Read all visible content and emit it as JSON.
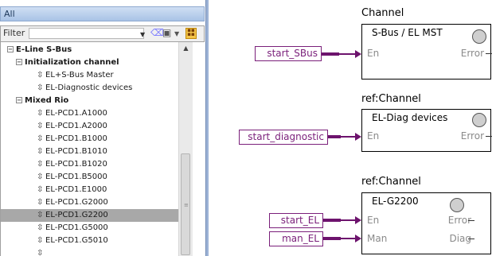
{
  "library": {
    "tab_label": "All",
    "filter_label": "Filter",
    "filter_value": "",
    "tree": [
      {
        "label": "E-Line S-Bus",
        "type": "group",
        "level": 0
      },
      {
        "label": "Initialization channel",
        "type": "group",
        "level": 1
      },
      {
        "label": "EL+S-Bus Master",
        "type": "leaf",
        "level": 2
      },
      {
        "label": "EL-Diagnostic devices",
        "type": "leaf",
        "level": 2
      },
      {
        "label": "Mixed Rio",
        "type": "group",
        "level": 1
      },
      {
        "label": "EL-PCD1.A1000",
        "type": "leaf",
        "level": 2
      },
      {
        "label": "EL-PCD1.A2000",
        "type": "leaf",
        "level": 2
      },
      {
        "label": "EL-PCD1.B1000",
        "type": "leaf",
        "level": 2
      },
      {
        "label": "EL-PCD1.B1010",
        "type": "leaf",
        "level": 2
      },
      {
        "label": "EL-PCD1.B1020",
        "type": "leaf",
        "level": 2
      },
      {
        "label": "EL-PCD1.B5000",
        "type": "leaf",
        "level": 2
      },
      {
        "label": "EL-PCD1.E1000",
        "type": "leaf",
        "level": 2
      },
      {
        "label": "EL-PCD1.G2000",
        "type": "leaf",
        "level": 2
      },
      {
        "label": "EL-PCD1.G2200",
        "type": "leaf",
        "level": 2,
        "selected": true
      },
      {
        "label": "EL-PCD1.G5000",
        "type": "leaf",
        "level": 2
      },
      {
        "label": "EL-PCD1.G5010",
        "type": "leaf",
        "level": 2
      }
    ]
  },
  "diagram": {
    "blocks": [
      {
        "title": "Channel",
        "name": "S-Bus / EL MST",
        "in_ports": [
          "En"
        ],
        "out_ports": [
          "Error"
        ]
      },
      {
        "title": "ref:Channel",
        "name": "EL-Diag devices",
        "in_ports": [
          "En"
        ],
        "out_ports": [
          "Error"
        ]
      },
      {
        "title": "ref:Channel",
        "name": "EL-G2200",
        "in_ports": [
          "En",
          "Man"
        ],
        "out_ports": [
          "Error",
          "Diag"
        ]
      }
    ],
    "signals": [
      "start_SBus",
      "start_diagnostic",
      "start_EL",
      "man_EL"
    ]
  },
  "colors": {
    "signal": "#7a1f7a",
    "wire": "#6d136d",
    "selection": "#a8a8a8"
  }
}
